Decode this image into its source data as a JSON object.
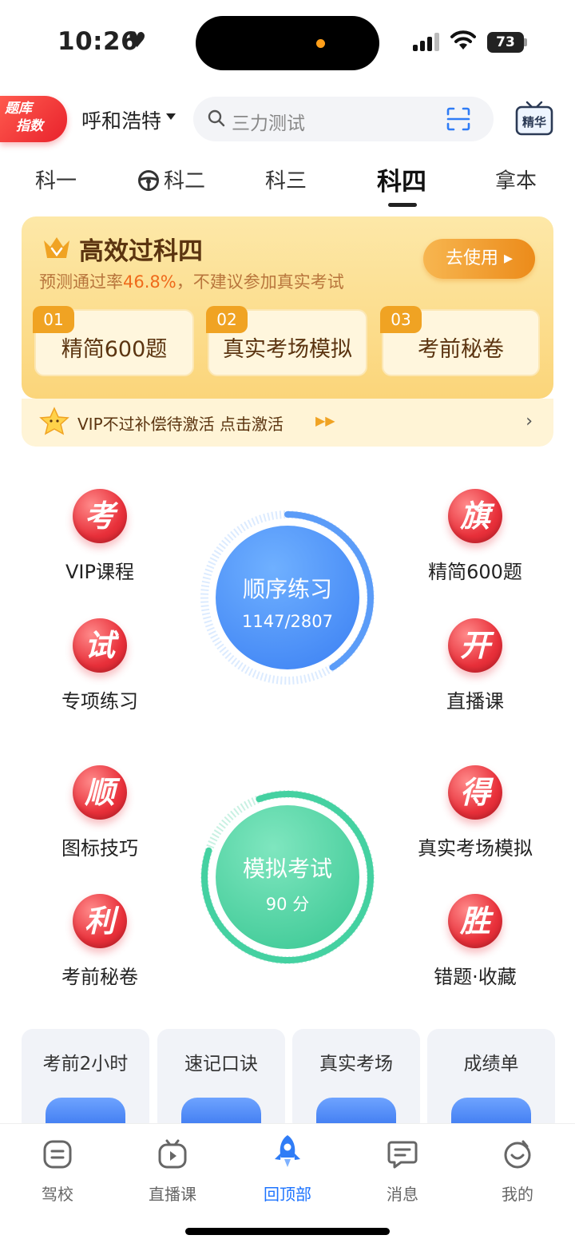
{
  "status": {
    "time": "10:26",
    "battery": "73"
  },
  "header": {
    "brand_line1": "题库",
    "brand_line2": "指数",
    "city": "呼和浩特",
    "search_placeholder": "三力测试",
    "essence_label": "精华"
  },
  "tabs": [
    {
      "label": "科一"
    },
    {
      "label": "科二"
    },
    {
      "label": "科三"
    },
    {
      "label": "科四",
      "active": true
    },
    {
      "label": "拿本"
    }
  ],
  "promo": {
    "title": "高效过科四",
    "subtitle_prefix": "预测通过率",
    "subtitle_rate": "46.8%",
    "subtitle_suffix": "，不建议参加真实考试",
    "use_button": "去使用 ▸",
    "steps": [
      {
        "num": "01",
        "label": "精简600题"
      },
      {
        "num": "02",
        "label": "真实考场模拟"
      },
      {
        "num": "03",
        "label": "考前秘卷"
      }
    ],
    "vip_text": "VIP不过补偿待激活 点击激活",
    "vip_arrows": "▶▶"
  },
  "grid": [
    {
      "glyph": "考",
      "label": "VIP课程"
    },
    {
      "glyph": "旗",
      "label": "精简600题"
    },
    {
      "glyph": "试",
      "label": "专项练习"
    },
    {
      "glyph": "开",
      "label": "直播课"
    },
    {
      "glyph": "顺",
      "label": "图标技巧"
    },
    {
      "glyph": "得",
      "label": "真实考场模拟"
    },
    {
      "glyph": "利",
      "label": "考前秘卷"
    },
    {
      "glyph": "胜",
      "label": "错题·收藏"
    }
  ],
  "practice": {
    "title": "顺序练习",
    "progress": "1147/2807",
    "done": 1147,
    "total": 2807,
    "color": "#4a8cf7"
  },
  "exam": {
    "title": "模拟考试",
    "score": "90 分",
    "color": "#3ecf9b"
  },
  "quick_cards": [
    {
      "label": "考前2小时"
    },
    {
      "label": "速记口诀"
    },
    {
      "label": "真实考场"
    },
    {
      "label": "成绩单"
    }
  ],
  "bottom_nav": [
    {
      "label": "驾校",
      "icon": "school-icon"
    },
    {
      "label": "直播课",
      "icon": "live-icon"
    },
    {
      "label": "回顶部",
      "icon": "rocket-icon",
      "active": true
    },
    {
      "label": "消息",
      "icon": "message-icon"
    },
    {
      "label": "我的",
      "icon": "profile-icon"
    }
  ],
  "colors": {
    "accent_blue": "#1e74ff",
    "brand_red": "#e8222c",
    "promo_orange": "#f0a323"
  }
}
